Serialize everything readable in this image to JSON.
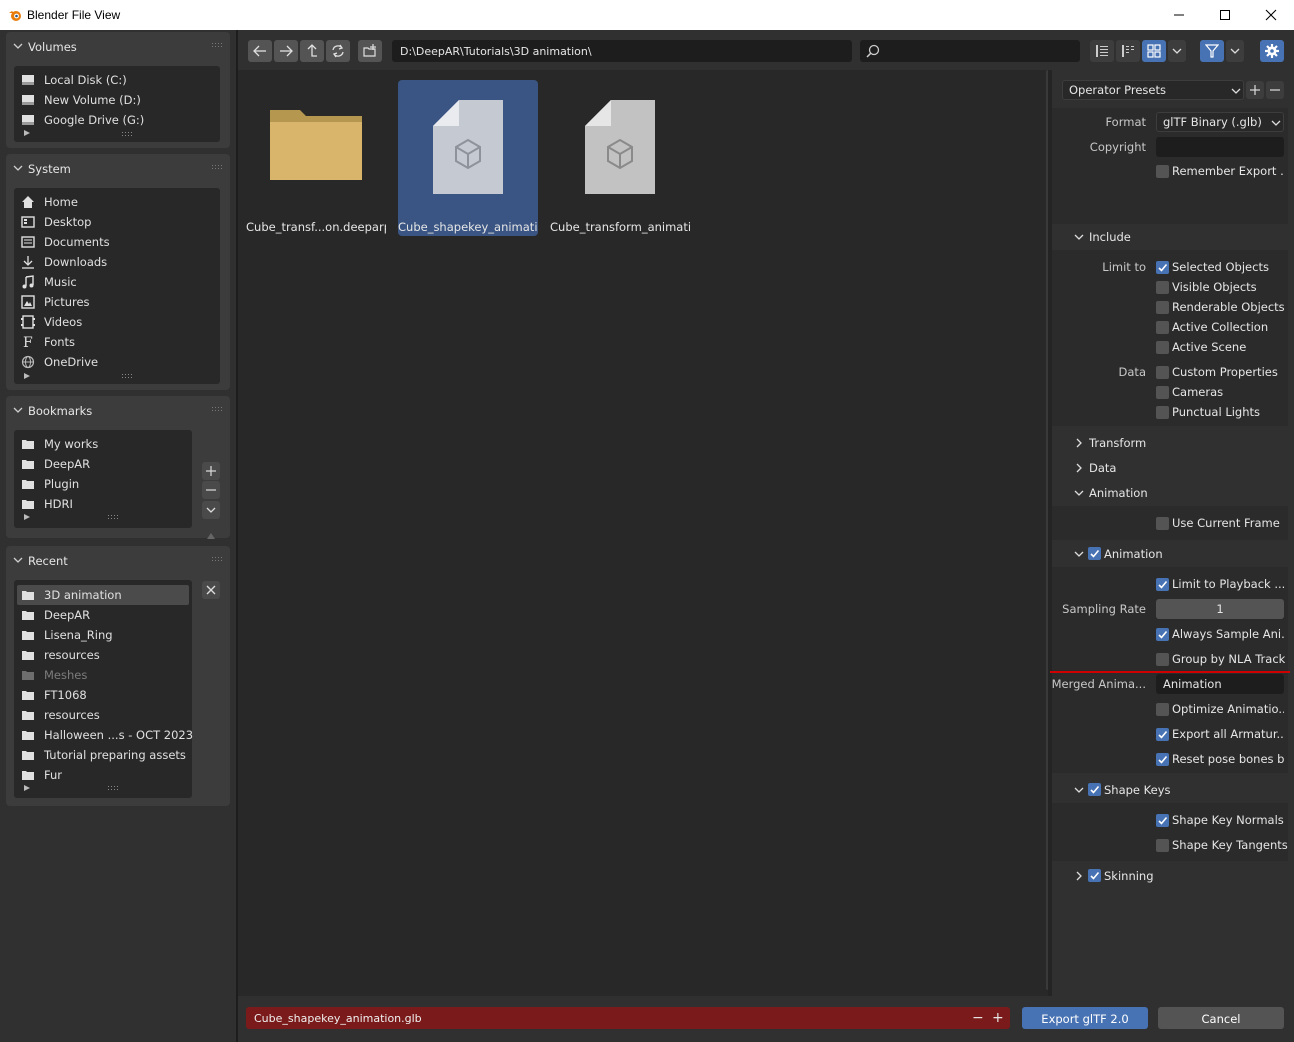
{
  "window": {
    "title": "Blender File View"
  },
  "colors": {
    "accent": "#4772b3",
    "selected_tile": "#3a5583",
    "filename_error": "#7a1a1a",
    "folder": "#d8b56a",
    "annotation_line": "#d00000"
  },
  "sidebar": {
    "volumes": {
      "title": "Volumes",
      "items": [
        {
          "label": "Local Disk (C:)",
          "icon": "drive-icon"
        },
        {
          "label": "New Volume (D:)",
          "icon": "drive-icon"
        },
        {
          "label": "Google Drive (G:)",
          "icon": "drive-icon"
        }
      ]
    },
    "system": {
      "title": "System",
      "items": [
        {
          "label": "Home",
          "icon": "home-icon"
        },
        {
          "label": "Desktop",
          "icon": "desktop-icon"
        },
        {
          "label": "Documents",
          "icon": "documents-icon"
        },
        {
          "label": "Downloads",
          "icon": "downloads-icon"
        },
        {
          "label": "Music",
          "icon": "music-icon"
        },
        {
          "label": "Pictures",
          "icon": "pictures-icon"
        },
        {
          "label": "Videos",
          "icon": "videos-icon"
        },
        {
          "label": "Fonts",
          "icon": "fonts-icon"
        },
        {
          "label": "OneDrive",
          "icon": "network-icon"
        }
      ]
    },
    "bookmarks": {
      "title": "Bookmarks",
      "items": [
        {
          "label": "My works"
        },
        {
          "label": "DeepAR"
        },
        {
          "label": "Plugin"
        },
        {
          "label": "HDRI"
        }
      ]
    },
    "recent": {
      "title": "Recent",
      "items": [
        {
          "label": "3D animation",
          "active": true
        },
        {
          "label": "DeepAR"
        },
        {
          "label": "Lisena_Ring"
        },
        {
          "label": "resources"
        },
        {
          "label": "Meshes",
          "dim": true
        },
        {
          "label": "FT1068"
        },
        {
          "label": "resources"
        },
        {
          "label": "Halloween ...s - OCT 2023"
        },
        {
          "label": "Tutorial preparing assets"
        },
        {
          "label": "Fur"
        }
      ]
    }
  },
  "toolbar": {
    "path": "D:\\DeepAR\\Tutorials\\3D animation\\",
    "search_placeholder": ""
  },
  "files": [
    {
      "name": "Cube_transf...on.deeparproj",
      "type": "folder",
      "selected": false
    },
    {
      "name": "Cube_shapekey_animatio...",
      "type": "file",
      "selected": true
    },
    {
      "name": "Cube_transform_animatio...",
      "type": "file",
      "selected": false
    }
  ],
  "bottom": {
    "filename": "Cube_shapekey_animation.glb",
    "export_label": "Export glTF 2.0",
    "cancel_label": "Cancel"
  },
  "operator": {
    "presets_label": "Operator Presets",
    "format_label": "Format",
    "format_value": "glTF Binary (.glb)",
    "copyright_label": "Copyright",
    "copyright_value": "",
    "remember_label": "Remember Export ...",
    "include": {
      "title": "Include",
      "limit_to_label": "Limit to",
      "data_label": "Data",
      "selected_objects": "Selected Objects",
      "visible_objects": "Visible Objects",
      "renderable_objects": "Renderable Objects",
      "active_collection": "Active Collection",
      "active_scene": "Active Scene",
      "custom_properties": "Custom Properties",
      "cameras": "Cameras",
      "punctual_lights": "Punctual Lights"
    },
    "transform_title": "Transform",
    "data_title": "Data",
    "animation_section": {
      "title": "Animation",
      "use_current_frame": "Use Current Frame"
    },
    "animation_sub": {
      "title": "Animation",
      "limit_playback": "Limit to Playback ...",
      "sampling_rate_label": "Sampling Rate",
      "sampling_rate_value": "1",
      "always_sample": "Always Sample Ani...",
      "group_nla": "Group by NLA Track",
      "merged_label": "Merged Anima...",
      "merged_value": "Animation",
      "optimize": "Optimize Animatio...",
      "export_armatures": "Export all Armatur...",
      "reset_pose": "Reset pose bones b..."
    },
    "shape_keys": {
      "title": "Shape Keys",
      "normals": "Shape Key Normals",
      "tangents": "Shape Key Tangents"
    },
    "skinning_title": "Skinning"
  }
}
